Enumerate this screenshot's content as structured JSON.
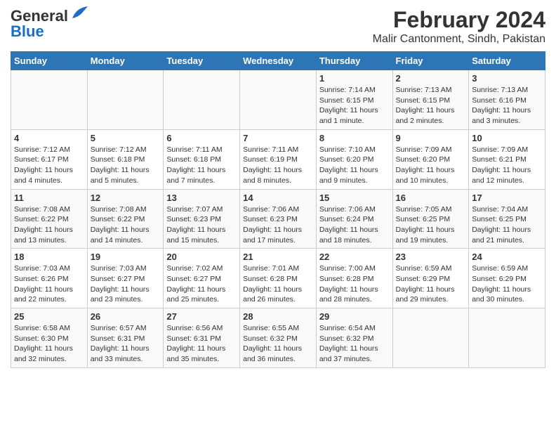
{
  "logo": {
    "line1": "General",
    "line2": "Blue"
  },
  "title": "February 2024",
  "subtitle": "Malir Cantonment, Sindh, Pakistan",
  "weekdays": [
    "Sunday",
    "Monday",
    "Tuesday",
    "Wednesday",
    "Thursday",
    "Friday",
    "Saturday"
  ],
  "weeks": [
    [
      {
        "day": "",
        "info": ""
      },
      {
        "day": "",
        "info": ""
      },
      {
        "day": "",
        "info": ""
      },
      {
        "day": "",
        "info": ""
      },
      {
        "day": "1",
        "info": "Sunrise: 7:14 AM\nSunset: 6:15 PM\nDaylight: 11 hours\nand 1 minute."
      },
      {
        "day": "2",
        "info": "Sunrise: 7:13 AM\nSunset: 6:15 PM\nDaylight: 11 hours\nand 2 minutes."
      },
      {
        "day": "3",
        "info": "Sunrise: 7:13 AM\nSunset: 6:16 PM\nDaylight: 11 hours\nand 3 minutes."
      }
    ],
    [
      {
        "day": "4",
        "info": "Sunrise: 7:12 AM\nSunset: 6:17 PM\nDaylight: 11 hours\nand 4 minutes."
      },
      {
        "day": "5",
        "info": "Sunrise: 7:12 AM\nSunset: 6:18 PM\nDaylight: 11 hours\nand 5 minutes."
      },
      {
        "day": "6",
        "info": "Sunrise: 7:11 AM\nSunset: 6:18 PM\nDaylight: 11 hours\nand 7 minutes."
      },
      {
        "day": "7",
        "info": "Sunrise: 7:11 AM\nSunset: 6:19 PM\nDaylight: 11 hours\nand 8 minutes."
      },
      {
        "day": "8",
        "info": "Sunrise: 7:10 AM\nSunset: 6:20 PM\nDaylight: 11 hours\nand 9 minutes."
      },
      {
        "day": "9",
        "info": "Sunrise: 7:09 AM\nSunset: 6:20 PM\nDaylight: 11 hours\nand 10 minutes."
      },
      {
        "day": "10",
        "info": "Sunrise: 7:09 AM\nSunset: 6:21 PM\nDaylight: 11 hours\nand 12 minutes."
      }
    ],
    [
      {
        "day": "11",
        "info": "Sunrise: 7:08 AM\nSunset: 6:22 PM\nDaylight: 11 hours\nand 13 minutes."
      },
      {
        "day": "12",
        "info": "Sunrise: 7:08 AM\nSunset: 6:22 PM\nDaylight: 11 hours\nand 14 minutes."
      },
      {
        "day": "13",
        "info": "Sunrise: 7:07 AM\nSunset: 6:23 PM\nDaylight: 11 hours\nand 15 minutes."
      },
      {
        "day": "14",
        "info": "Sunrise: 7:06 AM\nSunset: 6:23 PM\nDaylight: 11 hours\nand 17 minutes."
      },
      {
        "day": "15",
        "info": "Sunrise: 7:06 AM\nSunset: 6:24 PM\nDaylight: 11 hours\nand 18 minutes."
      },
      {
        "day": "16",
        "info": "Sunrise: 7:05 AM\nSunset: 6:25 PM\nDaylight: 11 hours\nand 19 minutes."
      },
      {
        "day": "17",
        "info": "Sunrise: 7:04 AM\nSunset: 6:25 PM\nDaylight: 11 hours\nand 21 minutes."
      }
    ],
    [
      {
        "day": "18",
        "info": "Sunrise: 7:03 AM\nSunset: 6:26 PM\nDaylight: 11 hours\nand 22 minutes."
      },
      {
        "day": "19",
        "info": "Sunrise: 7:03 AM\nSunset: 6:27 PM\nDaylight: 11 hours\nand 23 minutes."
      },
      {
        "day": "20",
        "info": "Sunrise: 7:02 AM\nSunset: 6:27 PM\nDaylight: 11 hours\nand 25 minutes."
      },
      {
        "day": "21",
        "info": "Sunrise: 7:01 AM\nSunset: 6:28 PM\nDaylight: 11 hours\nand 26 minutes."
      },
      {
        "day": "22",
        "info": "Sunrise: 7:00 AM\nSunset: 6:28 PM\nDaylight: 11 hours\nand 28 minutes."
      },
      {
        "day": "23",
        "info": "Sunrise: 6:59 AM\nSunset: 6:29 PM\nDaylight: 11 hours\nand 29 minutes."
      },
      {
        "day": "24",
        "info": "Sunrise: 6:59 AM\nSunset: 6:29 PM\nDaylight: 11 hours\nand 30 minutes."
      }
    ],
    [
      {
        "day": "25",
        "info": "Sunrise: 6:58 AM\nSunset: 6:30 PM\nDaylight: 11 hours\nand 32 minutes."
      },
      {
        "day": "26",
        "info": "Sunrise: 6:57 AM\nSunset: 6:31 PM\nDaylight: 11 hours\nand 33 minutes."
      },
      {
        "day": "27",
        "info": "Sunrise: 6:56 AM\nSunset: 6:31 PM\nDaylight: 11 hours\nand 35 minutes."
      },
      {
        "day": "28",
        "info": "Sunrise: 6:55 AM\nSunset: 6:32 PM\nDaylight: 11 hours\nand 36 minutes."
      },
      {
        "day": "29",
        "info": "Sunrise: 6:54 AM\nSunset: 6:32 PM\nDaylight: 11 hours\nand 37 minutes."
      },
      {
        "day": "",
        "info": ""
      },
      {
        "day": "",
        "info": ""
      }
    ]
  ]
}
